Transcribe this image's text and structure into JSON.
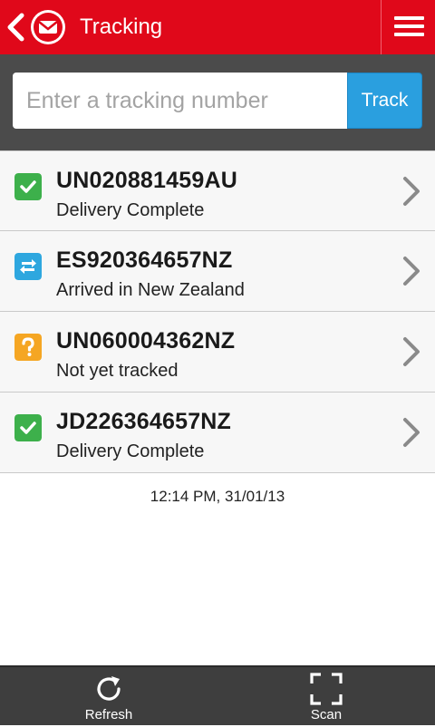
{
  "header": {
    "title": "Tracking",
    "brand_color": "#e0081a",
    "icons": {
      "back": "chevron-left-icon",
      "logo": "post-logo-icon",
      "menu": "hamburger-menu-icon"
    }
  },
  "search": {
    "placeholder": "Enter a tracking number",
    "value": "",
    "track_label": "Track",
    "track_color": "#2a9fdf"
  },
  "shipments": [
    {
      "id": "UN020881459AU",
      "status": "Delivery Complete",
      "icon": "check-icon",
      "icon_color": "#3db04b"
    },
    {
      "id": "ES920364657NZ",
      "status": "Arrived in New Zealand",
      "icon": "transit-arrows-icon",
      "icon_color": "#2ea7df"
    },
    {
      "id": "UN060004362NZ",
      "status": "Not yet tracked",
      "icon": "question-icon",
      "icon_color": "#f5a623"
    },
    {
      "id": "JD226364657NZ",
      "status": "Delivery Complete",
      "icon": "check-icon",
      "icon_color": "#3db04b"
    }
  ],
  "last_updated": "12:14 PM, 31/01/13",
  "bottom_bar": {
    "refresh_label": "Refresh",
    "scan_label": "Scan"
  }
}
